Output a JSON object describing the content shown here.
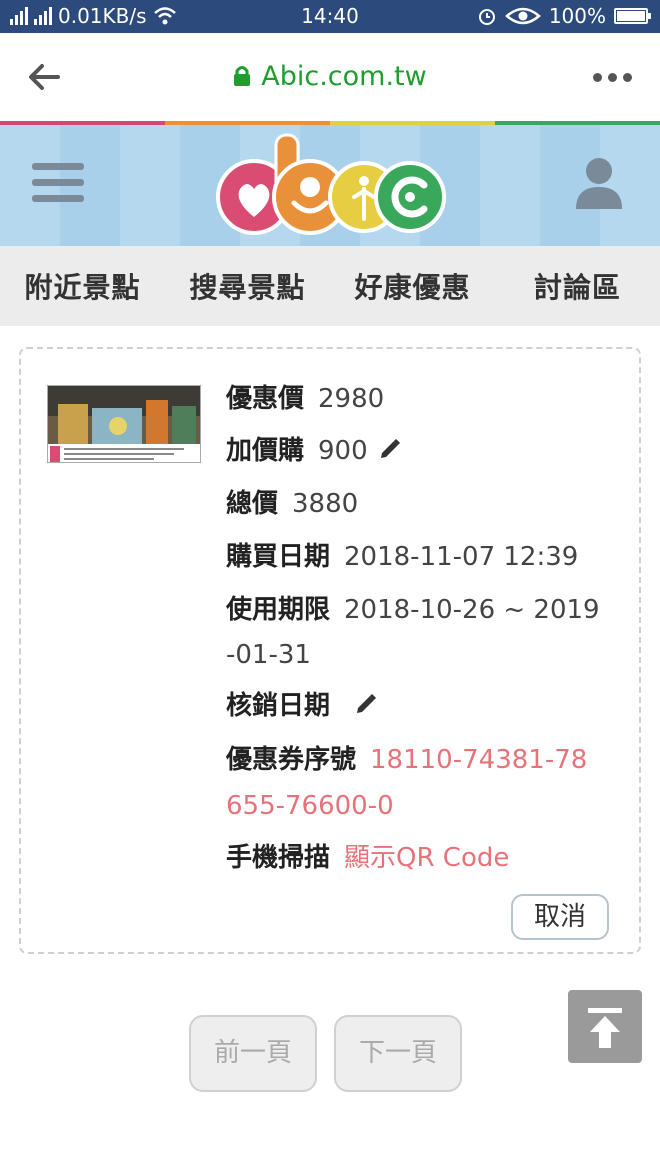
{
  "status_bar": {
    "network_speed": "0.01KB/s",
    "time": "14:40",
    "battery": "100%"
  },
  "browser": {
    "url": "Abic.com.tw"
  },
  "colors": {
    "stripe": [
      "#d2486e",
      "#e8913a",
      "#e6cd42",
      "#39a85a"
    ],
    "url_green": "#1e9e2e",
    "highlight_red": "#e8727a"
  },
  "nav": {
    "items": [
      "附近景點",
      "搜尋景點",
      "好康優惠",
      "討論區"
    ]
  },
  "coupon": {
    "discount_price_label": "優惠價",
    "discount_price": "2980",
    "addon_label": "加價購",
    "addon_price": "900",
    "total_label": "總價",
    "total": "3880",
    "purchase_date_label": "購買日期",
    "purchase_date": "2018-11-07 12:39",
    "validity_label": "使用期限",
    "validity_line1": "2018-10-26 ~ 2019",
    "validity_line2": "-01-31",
    "redeem_date_label": "核銷日期",
    "serial_label": "優惠券序號",
    "serial_line1": "18110-74381-78",
    "serial_line2": "655-76600-0",
    "scan_label": "手機掃描",
    "scan_link": "顯示QR Code",
    "cancel_button": "取消"
  },
  "pager": {
    "prev": "前一頁",
    "next": "下一頁"
  },
  "icons": [
    "signal-icon",
    "wifi-icon",
    "alarm-icon",
    "eye-icon",
    "battery-icon",
    "back-arrow-icon",
    "lock-icon",
    "more-icon",
    "hamburger-icon",
    "user-icon",
    "pencil-icon",
    "scroll-top-icon"
  ]
}
